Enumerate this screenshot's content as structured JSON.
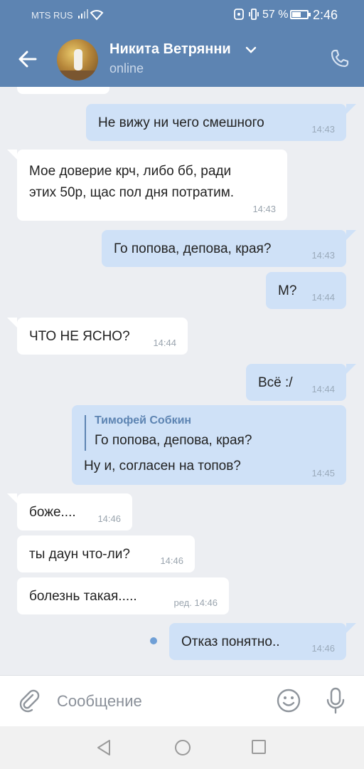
{
  "status_bar": {
    "carrier": "MTS RUS",
    "battery": "57 %",
    "time": "2:46"
  },
  "header": {
    "contact_name": "Никита Ветрянни",
    "status": "online"
  },
  "messages": [
    {
      "id": 0,
      "direction": "out",
      "text": "Не вижу ни чего смешного",
      "time": "14:43"
    },
    {
      "id": 1,
      "direction": "in",
      "lines": [
        "Мое доверие крч, либо бб, ради",
        "этих 50р, щас пол дня потратим."
      ],
      "time": "14:43"
    },
    {
      "id": 2,
      "direction": "out",
      "text": "Го попова, депова, края?",
      "time": "14:43"
    },
    {
      "id": 3,
      "direction": "out",
      "text": "М?",
      "time": "14:44"
    },
    {
      "id": 4,
      "direction": "in",
      "text": "ЧТО НЕ ЯСНО?",
      "time": "14:44"
    },
    {
      "id": 5,
      "direction": "out",
      "text": "Всё :/",
      "time": "14:44"
    },
    {
      "id": 6,
      "direction": "out",
      "quote_author": "Тимофей Собкин",
      "quote_text": "Го попова, депова, края?",
      "text": "Ну и, согласен на топов?",
      "time": "14:45"
    },
    {
      "id": 7,
      "direction": "in",
      "text": "боже....",
      "time": "14:46"
    },
    {
      "id": 8,
      "direction": "in",
      "text": "ты даун что-ли?",
      "time": "14:46"
    },
    {
      "id": 9,
      "direction": "in",
      "text": "болезнь такая.....",
      "time": "ред. 14:46"
    },
    {
      "id": 10,
      "direction": "out",
      "text": "Отказ понятно..",
      "time": "14:46",
      "unread": true
    }
  ],
  "composer": {
    "placeholder": "Сообщение"
  },
  "colors": {
    "header": "#5d84b2",
    "outgoing_bubble": "#cfe1f7",
    "incoming_bubble": "#ffffff",
    "chat_background": "#eceef2",
    "accent": "#5d84b2"
  },
  "icons": {
    "back": "arrow-left-icon",
    "call": "phone-icon",
    "attach": "paperclip-icon",
    "emoji": "smiley-icon",
    "mic": "microphone-icon"
  }
}
